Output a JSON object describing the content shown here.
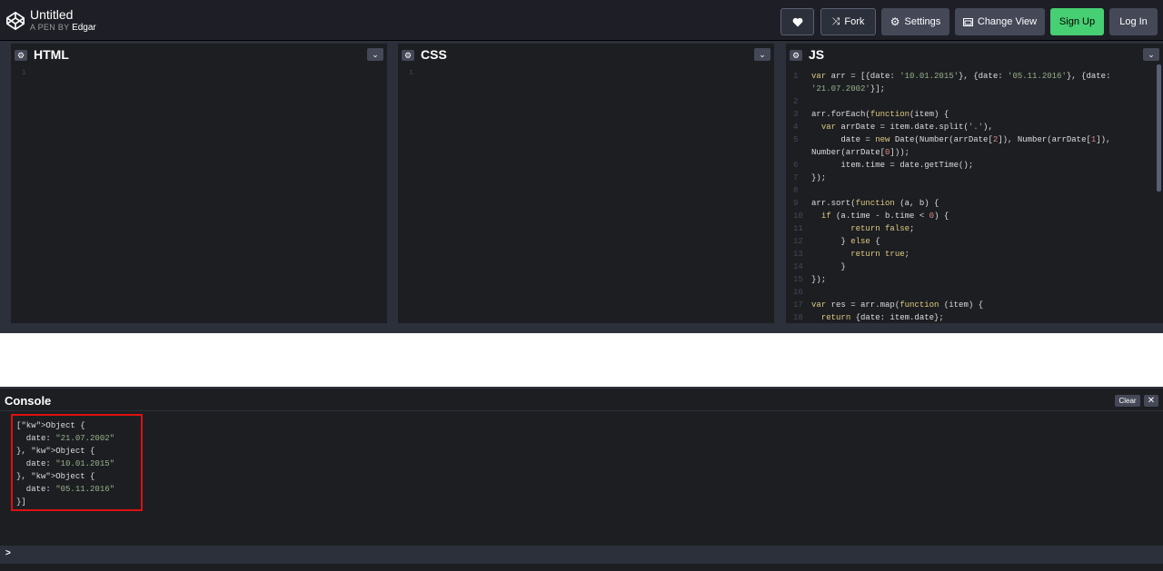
{
  "header": {
    "title": "Untitled",
    "pen_by": "A PEN BY",
    "author": "Edgar",
    "buttons": {
      "fork": "Fork",
      "settings": "Settings",
      "change_view": "Change View",
      "sign_up": "Sign Up",
      "log_in": "Log In"
    }
  },
  "editors": {
    "html": {
      "name": "HTML",
      "line": "1"
    },
    "css": {
      "name": "CSS",
      "line": "1"
    },
    "js": {
      "name": "JS",
      "lines": [
        "var arr = [{date: '10.01.2015'}, {date: '05.11.2016'}, {date:",
        "'21.07.2002'}];",
        "",
        "arr.forEach(function(item) {",
        "  var arrDate = item.date.split('.'),",
        "      date = new Date(Number(arrDate[2]), Number(arrDate[1]),",
        "Number(arrDate[0]));",
        "      item.time = date.getTime();",
        "});",
        "",
        "arr.sort(function (a, b) {",
        "  if (a.time - b.time < 0) {",
        "        return false;",
        "      } else {",
        "        return true;",
        "      }",
        "});",
        "",
        "var res = arr.map(function (item) {",
        "  return {date: item.date};"
      ]
    }
  },
  "console": {
    "title": "Console",
    "clear": "Clear",
    "close": "✕",
    "output": [
      "[Object {",
      "  date: \"21.07.2002\"",
      "}, Object {",
      "  date: \"10.01.2015\"",
      "}, Object {",
      "  date: \"05.11.2016\"",
      "}]"
    ],
    "prompt": ">"
  }
}
